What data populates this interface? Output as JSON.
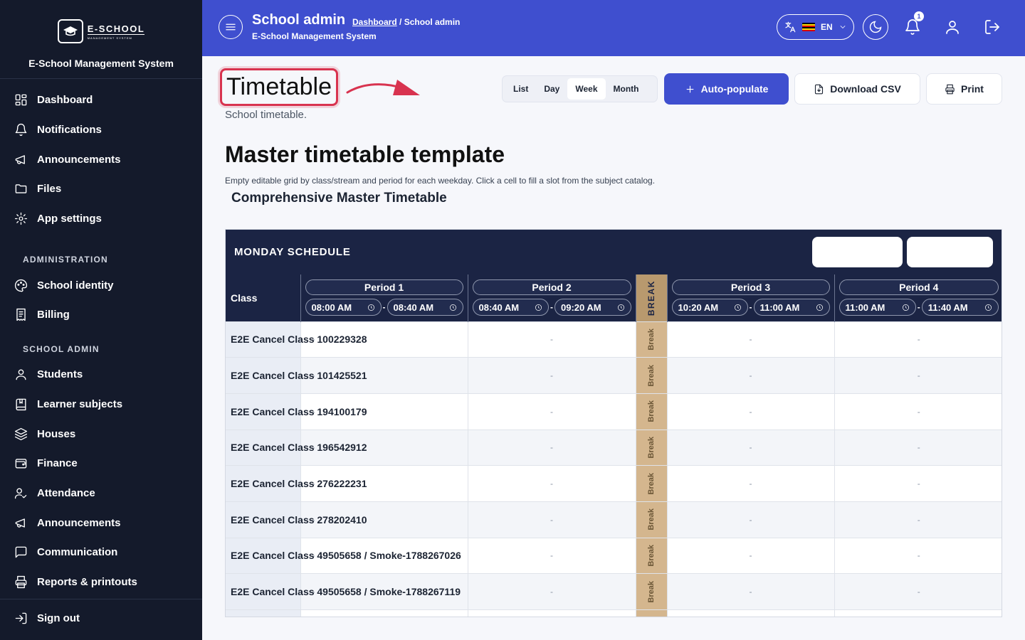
{
  "app": {
    "logo_main": "E-SCHOOL",
    "logo_sub": "MANAGEMENT SYSTEM",
    "system_name": "E-School Management System"
  },
  "sidebar": {
    "top_items": [
      {
        "label": "Dashboard",
        "icon": "dashboard-icon"
      },
      {
        "label": "Notifications",
        "icon": "bell-icon"
      },
      {
        "label": "Announcements",
        "icon": "megaphone-icon"
      },
      {
        "label": "Files",
        "icon": "folder-icon"
      },
      {
        "label": "App settings",
        "icon": "gear-icon"
      }
    ],
    "admin_section": "ADMINISTRATION",
    "admin_items": [
      {
        "label": "School identity",
        "icon": "palette-icon"
      },
      {
        "label": "Billing",
        "icon": "receipt-icon"
      }
    ],
    "school_section": "SCHOOL ADMIN",
    "school_items": [
      {
        "label": "Students",
        "icon": "user-icon"
      },
      {
        "label": "Learner subjects",
        "icon": "book-icon"
      },
      {
        "label": "Houses",
        "icon": "layers-icon"
      },
      {
        "label": "Finance",
        "icon": "wallet-icon"
      },
      {
        "label": "Attendance",
        "icon": "user-check-icon"
      },
      {
        "label": "Announcements",
        "icon": "megaphone-icon"
      },
      {
        "label": "Communication",
        "icon": "message-icon"
      },
      {
        "label": "Reports & printouts",
        "icon": "printer-icon"
      }
    ],
    "sign_out": "Sign out"
  },
  "header": {
    "title": "School admin",
    "breadcrumb_link": "Dashboard",
    "breadcrumb_current": "/ School admin",
    "subtitle": "E-School Management System",
    "language": "EN",
    "notification_count": "1",
    "bg_color": "#3f4fcf"
  },
  "page": {
    "title": "Timetable",
    "subtitle": "School timetable.",
    "view_options": [
      "List",
      "Day",
      "Week",
      "Month"
    ],
    "active_view": "Week",
    "auto_populate": "Auto-populate",
    "download_csv": "Download CSV",
    "print": "Print",
    "section_title": "Master timetable template",
    "section_desc": "Empty editable grid by class/stream and period for each weekday. Click a cell to fill a slot from the subject catalog.",
    "sub_title": "Comprehensive Master Timetable"
  },
  "schedule": {
    "day_label": "MONDAY SCHEDULE",
    "class_header": "Class",
    "break_header": "BREAK",
    "break_cell": "Break",
    "empty_cell": "-",
    "periods": [
      {
        "name": "Period 1",
        "start": "08:00 AM",
        "end": "08:40 AM"
      },
      {
        "name": "Period 2",
        "start": "08:40 AM",
        "end": "09:20 AM"
      },
      {
        "name": "Period 3",
        "start": "10:20 AM",
        "end": "11:00 AM"
      },
      {
        "name": "Period 4",
        "start": "11:00 AM",
        "end": "11:40 AM"
      }
    ],
    "rows": [
      "E2E Cancel Class 100229328",
      "E2E Cancel Class 101425521",
      "E2E Cancel Class 194100179",
      "E2E Cancel Class 196542912",
      "E2E Cancel Class 276222231",
      "E2E Cancel Class 278202410",
      "E2E Cancel Class 49505658 / Smoke-1788267026",
      "E2E Cancel Class 49505658 / Smoke-1788267119",
      ""
    ]
  }
}
